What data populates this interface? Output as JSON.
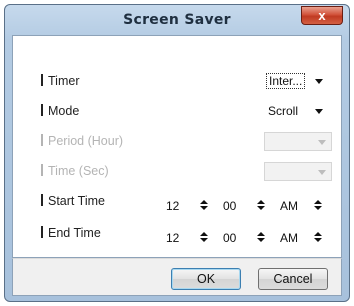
{
  "window": {
    "title": "Screen Saver",
    "close_glyph": "x"
  },
  "fields": {
    "timer": {
      "label": "Timer",
      "value": "Inter..."
    },
    "mode": {
      "label": "Mode",
      "value": "Scroll"
    },
    "period": {
      "label": "Period (Hour)",
      "value": "",
      "disabled": true
    },
    "time": {
      "label": "Time (Sec)",
      "value": "",
      "disabled": true
    },
    "start_time": {
      "label": "Start Time",
      "hour": "12",
      "minute": "00",
      "ampm": "AM"
    },
    "end_time": {
      "label": "End Time",
      "hour": "12",
      "minute": "00",
      "ampm": "AM"
    }
  },
  "buttons": {
    "ok": "OK",
    "cancel": "Cancel"
  },
  "icons": {
    "dropdown": "chevron-down-icon",
    "spinner": "spin-up-down-icon",
    "close": "close-icon"
  }
}
